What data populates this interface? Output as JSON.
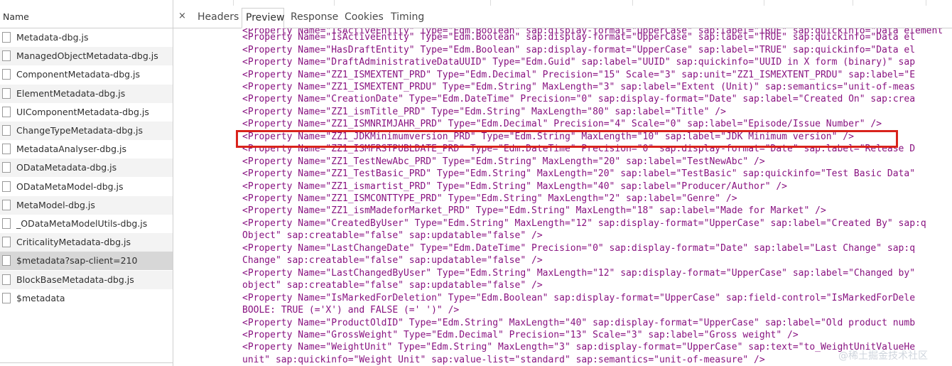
{
  "network_panel": {
    "name_column_header": "Name",
    "files": [
      {
        "label": "Metadata-dbg.js",
        "selected": false
      },
      {
        "label": "ManagedObjectMetadata-dbg.js",
        "selected": false
      },
      {
        "label": "ComponentMetadata-dbg.js",
        "selected": false
      },
      {
        "label": "ElementMetadata-dbg.js",
        "selected": false
      },
      {
        "label": "UIComponentMetadata-dbg.js",
        "selected": false
      },
      {
        "label": "ChangeTypeMetadata-dbg.js",
        "selected": false
      },
      {
        "label": "MetadataAnalyser-dbg.js",
        "selected": false
      },
      {
        "label": "ODataMetadata-dbg.js",
        "selected": false
      },
      {
        "label": "ODataMetaModel-dbg.js",
        "selected": false
      },
      {
        "label": "MetaModel-dbg.js",
        "selected": false
      },
      {
        "label": "_ODataMetaModelUtils-dbg.js",
        "selected": false
      },
      {
        "label": "CriticalityMetadata-dbg.js",
        "selected": false
      },
      {
        "label": "$metadata?sap-client=210",
        "selected": true
      },
      {
        "label": "BlockBaseMetadata-dbg.js",
        "selected": false
      },
      {
        "label": "$metadata",
        "selected": false
      }
    ]
  },
  "detail_panel": {
    "close_glyph": "×",
    "tabs": {
      "headers": "Headers",
      "preview": "Preview",
      "response": "Response",
      "cookies": "Cookies",
      "timing": "Timing"
    },
    "active_tab": "Preview",
    "code_lines": [
      "<Property Name=\"IsActiveEntity\" Type=\"Edm.Boolean\" sap:display-format=\"UpperCase\" sap:label=\"TRUE\" sap:quickinfo=\"Data element",
      "<Property Name=\"IsActiveEntity\" Type=\"Edm.Boolean\" sap:display-format=\"UpperCase\" sap:label=\"TRUE\" sap:quickinfo=\"Data el",
      "<Property Name=\"HasDraftEntity\" Type=\"Edm.Boolean\" sap:display-format=\"UpperCase\" sap:label=\"TRUE\" sap:quickinfo=\"Data el",
      "<Property Name=\"DraftAdministrativeDataUUID\" Type=\"Edm.Guid\" sap:label=\"UUID\" sap:quickinfo=\"UUID in X form (binary)\" sap",
      "<Property Name=\"ZZ1_ISMEXTENT_PRD\" Type=\"Edm.Decimal\" Precision=\"15\" Scale=\"3\" sap:unit=\"ZZ1_ISMEXTENT_PRDU\" sap:label=\"E",
      "<Property Name=\"ZZ1_ISMEXTENT_PRDU\" Type=\"Edm.String\" MaxLength=\"3\" sap:label=\"Extent (Unit)\" sap:semantics=\"unit-of-meas",
      "<Property Name=\"CreationDate\" Type=\"Edm.DateTime\" Precision=\"0\" sap:display-format=\"Date\" sap:label=\"Created On\" sap:crea",
      "<Property Name=\"ZZ1_ismTitle_PRD\" Type=\"Edm.String\" MaxLength=\"80\" sap:label=\"Title\" />",
      "<Property Name=\"ZZ1_ISMNRIMJAHR_PRD\" Type=\"Edm.Decimal\" Precision=\"4\" Scale=\"0\" sap:label=\"Episode/Issue Number\" />",
      "<Property Name=\"ZZ1_JDKMinimumversion_PRD\" Type=\"Edm.String\" MaxLength=\"10\" sap:label=\"JDK Minimum version\" />",
      "<Property Name=\"ZZ1_ISMFRSTPUBLDATE_PRD\" Type=\"Edm.DateTime\" Precision=\"0\" sap:display-format=\"Date\" sap:label=\"Release D",
      "<Property Name=\"ZZ1_TestNewAbc_PRD\" Type=\"Edm.String\" MaxLength=\"20\" sap:label=\"TestNewAbc\" />",
      "<Property Name=\"ZZ1_TestBasic_PRD\" Type=\"Edm.String\" MaxLength=\"20\" sap:label=\"TestBasic\" sap:quickinfo=\"Test Basic Data\"",
      "<Property Name=\"ZZ1_ismartist_PRD\" Type=\"Edm.String\" MaxLength=\"40\" sap:label=\"Producer/Author\" />",
      "<Property Name=\"ZZ1_ISMCONTTYPE_PRD\" Type=\"Edm.String\" MaxLength=\"2\" sap:label=\"Genre\" />",
      "<Property Name=\"ZZ1_ismMadeforMarket_PRD\" Type=\"Edm.String\" MaxLength=\"18\" sap:label=\"Made for Market\" />",
      "<Property Name=\"CreatedByUser\" Type=\"Edm.String\" MaxLength=\"12\" sap:display-format=\"UpperCase\" sap:label=\"Created By\" sap:q",
      "Object\" sap:creatable=\"false\" sap:updatable=\"false\" />",
      "<Property Name=\"LastChangeDate\" Type=\"Edm.DateTime\" Precision=\"0\" sap:display-format=\"Date\" sap:label=\"Last Change\" sap:q",
      "Change\" sap:creatable=\"false\" sap:updatable=\"false\" />",
      "<Property Name=\"LastChangedByUser\" Type=\"Edm.String\" MaxLength=\"12\" sap:display-format=\"UpperCase\" sap:label=\"Changed by\"",
      "object\" sap:creatable=\"false\" sap:updatable=\"false\" />",
      "<Property Name=\"IsMarkedForDeletion\" Type=\"Edm.Boolean\" sap:display-format=\"UpperCase\" sap:field-control=\"IsMarkedForDele",
      "BOOLE: TRUE (='X') and FALSE (=' ')\" />",
      "<Property Name=\"ProductOldID\" Type=\"Edm.String\" MaxLength=\"40\" sap:display-format=\"UpperCase\" sap:label=\"Old product numb",
      "<Property Name=\"GrossWeight\" Type=\"Edm.Decimal\" Precision=\"13\" Scale=\"3\" sap:label=\"Gross weight\" />",
      "<Property Name=\"WeightUnit\" Type=\"Edm.String\" MaxLength=\"3\" sap:display-format=\"UpperCase\" sap:text=\"to_WeightUnitValueHe",
      "unit\" sap:quickinfo=\"Weight Unit\" sap:value-list=\"standard\" sap:semantics=\"unit-of-measure\" />"
    ],
    "highlighted_line_index": 9
  },
  "watermark": "@稀土掘金技术社区",
  "colors": {
    "code_text": "#881280",
    "highlight_border": "#d9231c",
    "selected_row": "#d7d7d7"
  }
}
